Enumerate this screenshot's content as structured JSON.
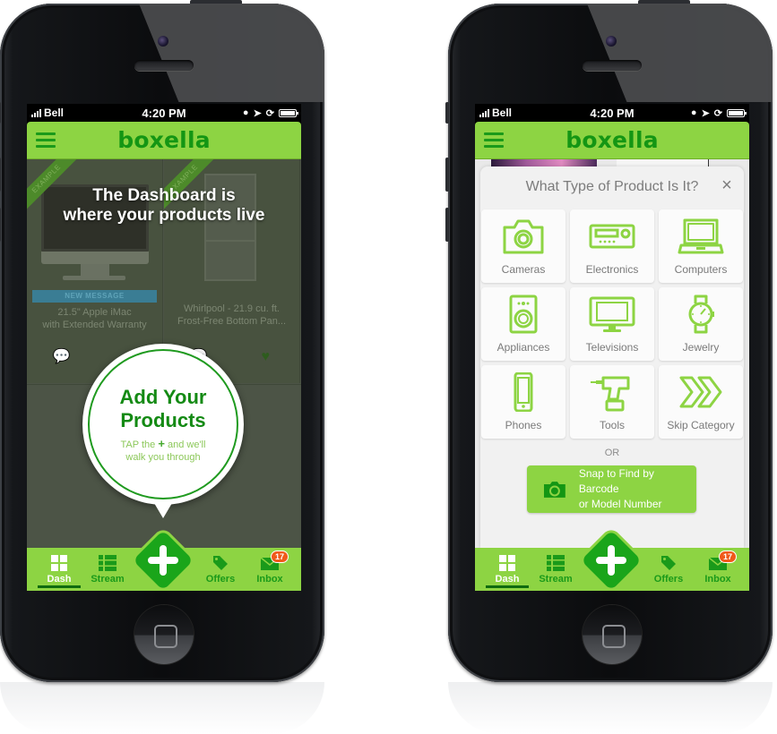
{
  "status_bar": {
    "carrier": "Bell",
    "time": "4:20 PM"
  },
  "app": {
    "logo": "boxella",
    "brand_color": "#8dd443",
    "accent_dark": "#1aa51a"
  },
  "left_phone": {
    "headline_line1": "The Dashboard is",
    "headline_line2": "where your products live",
    "cards": [
      {
        "ribbon": "EXAMPLE",
        "message_bar": "NEW MESSAGE",
        "title_line1": "21.5\" Apple iMac",
        "title_line2": "with Extended Warranty"
      },
      {
        "ribbon": "EXAMPLE",
        "title_line1": "Whirlpool - 21.9 cu. ft.",
        "title_line2": "Frost-Free Bottom Pan..."
      }
    ],
    "bubble": {
      "title_line1": "Add Your",
      "title_line2": "Products",
      "sub_prefix": "TAP the",
      "sub_plus": "+",
      "sub_suffix": "and we'll",
      "sub_line2": "walk you through"
    }
  },
  "right_phone": {
    "modal": {
      "title": "What Type of Product Is It?",
      "close_icon": "×",
      "categories": [
        {
          "label": "Cameras",
          "icon": "camera-icon"
        },
        {
          "label": "Electronics",
          "icon": "receiver-icon"
        },
        {
          "label": "Computers",
          "icon": "laptop-icon"
        },
        {
          "label": "Appliances",
          "icon": "washer-icon"
        },
        {
          "label": "Televisions",
          "icon": "tv-icon"
        },
        {
          "label": "Jewelry",
          "icon": "watch-icon"
        },
        {
          "label": "Phones",
          "icon": "phone-icon"
        },
        {
          "label": "Tools",
          "icon": "drill-icon"
        },
        {
          "label": "Skip Category",
          "icon": "double-chevron-icon"
        }
      ],
      "or_label": "OR",
      "snap_line1": "Snap to Find by Barcode",
      "snap_line2": "or Model Number"
    }
  },
  "tabbar": {
    "tabs": [
      {
        "label": "Dash",
        "active": true
      },
      {
        "label": "Stream",
        "active": false
      },
      {
        "label": "Offers",
        "active": false
      },
      {
        "label": "Inbox",
        "active": false,
        "badge": "17"
      }
    ]
  }
}
